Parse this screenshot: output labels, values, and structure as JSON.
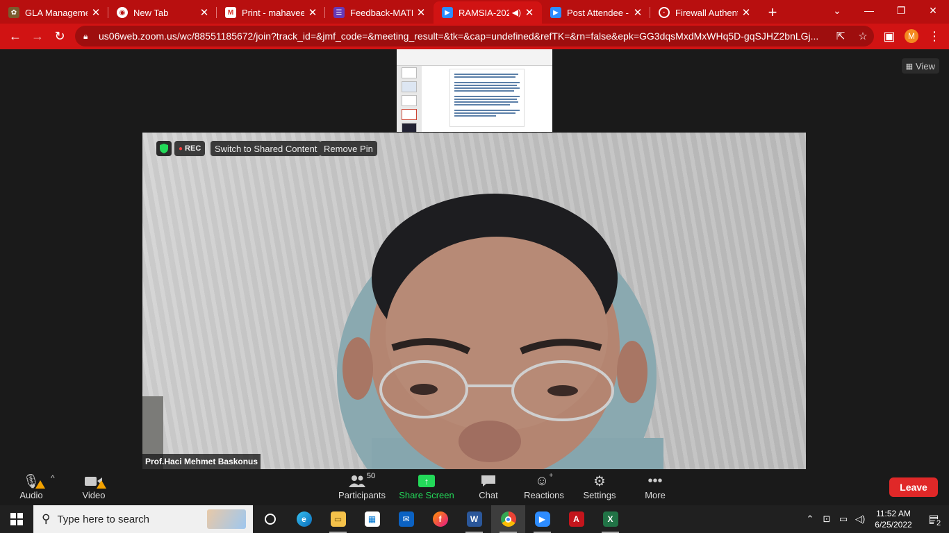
{
  "browser": {
    "tabs": [
      {
        "title": "GLA Managemen",
        "icon": "gla-favicon",
        "active": false
      },
      {
        "title": "New Tab",
        "icon": "chrome-icon",
        "active": false
      },
      {
        "title": "Print - mahaveer",
        "icon": "gmail-icon",
        "active": false
      },
      {
        "title": "Feedback-MATLA",
        "icon": "forms-icon",
        "active": false
      },
      {
        "title": "RAMSIA-202",
        "icon": "zoom-icon",
        "active": true,
        "audio": true
      },
      {
        "title": "Post Attendee - Z",
        "icon": "zoom-icon",
        "active": false
      },
      {
        "title": "Firewall Authentic",
        "icon": "globe-icon",
        "active": false
      }
    ],
    "url": "us06web.zoom.us/wc/88551185672/join?track_id=&jmf_code=&meeting_result=&tk=&cap=undefined&refTK=&rn=false&epk=GG3dqsMxdMxWHq5D-gqSJHZ2bnLGj...",
    "profile_initial": "M"
  },
  "meeting": {
    "view_label": "View",
    "rec_label": "REC",
    "switch_label": "Switch to Shared Content",
    "remove_pin_label": "Remove Pin",
    "speaker_name": "Prof.Haci Mehmet Baskonus"
  },
  "toolbar": {
    "audio": "Audio",
    "video": "Video",
    "participants": "Participants",
    "participants_count": "50",
    "share": "Share Screen",
    "chat": "Chat",
    "reactions": "Reactions",
    "settings": "Settings",
    "more": "More",
    "leave": "Leave"
  },
  "taskbar": {
    "search_placeholder": "Type here to search",
    "time": "11:52 AM",
    "date": "6/25/2022",
    "notifications": "2"
  },
  "colors": {
    "browser_frame": "#b80f0f",
    "zoom_bg": "#1a1a1a",
    "share_green": "#23d959",
    "leave_red": "#e02828"
  }
}
